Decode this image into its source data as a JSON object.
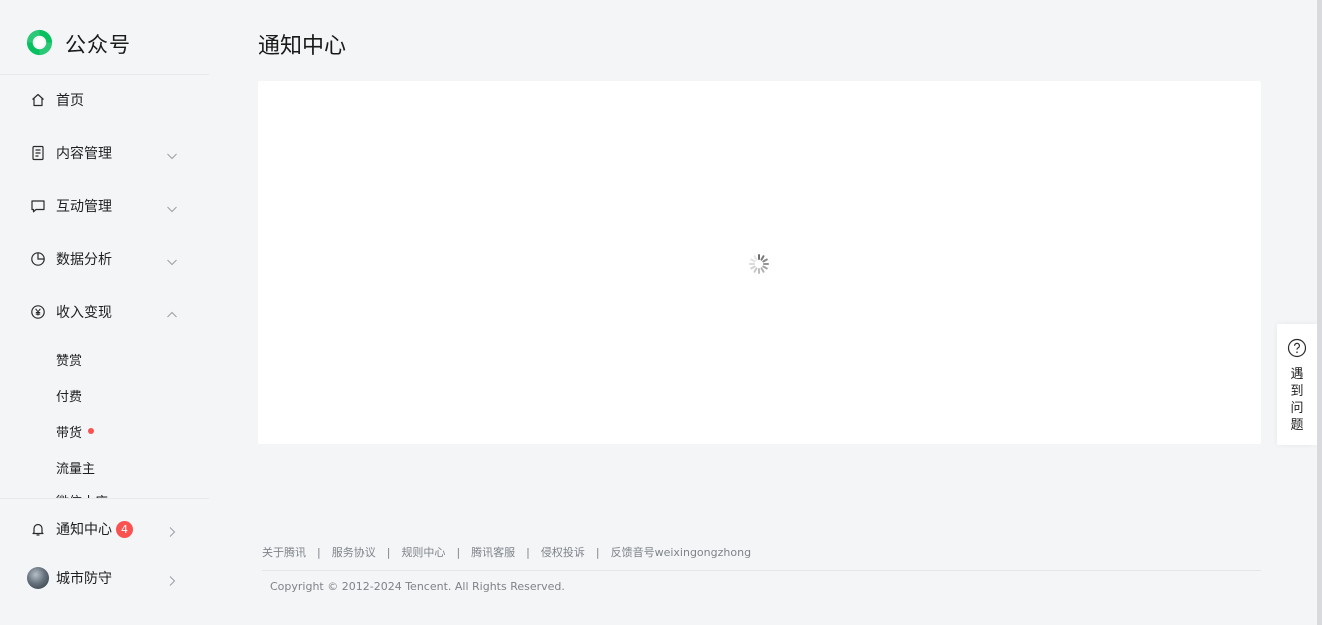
{
  "brand": {
    "name": "公众号",
    "accent": "#07c160"
  },
  "sidebar": {
    "home": {
      "label": "首页",
      "icon": "home-icon"
    },
    "menus": [
      {
        "label": "内容管理",
        "icon": "document-icon",
        "expanded": false
      },
      {
        "label": "互动管理",
        "icon": "chat-icon",
        "expanded": false
      },
      {
        "label": "数据分析",
        "icon": "pie-chart-icon",
        "expanded": false
      },
      {
        "label": "收入变现",
        "icon": "yuan-icon",
        "expanded": true
      }
    ],
    "income_sub": [
      {
        "label": "赞赏"
      },
      {
        "label": "付费"
      },
      {
        "label": "带货",
        "dot": true
      },
      {
        "label": "流量主"
      },
      {
        "label": "微信小店"
      }
    ],
    "notifications": {
      "label": "通知中心",
      "count": "4",
      "icon": "bell-icon"
    },
    "account": {
      "label": "城市防守"
    }
  },
  "main": {
    "title": "通知中心",
    "loading": true
  },
  "footer": {
    "links": [
      "关于腾讯",
      "服务协议",
      "规则中心",
      "腾讯客服",
      "侵权投诉",
      "反馈音号weixingongzhong"
    ],
    "copyright": "Copyright © 2012-2024 Tencent. All Rights Reserved."
  },
  "help": {
    "label": "遇到问题",
    "icon": "question-circle-icon"
  }
}
